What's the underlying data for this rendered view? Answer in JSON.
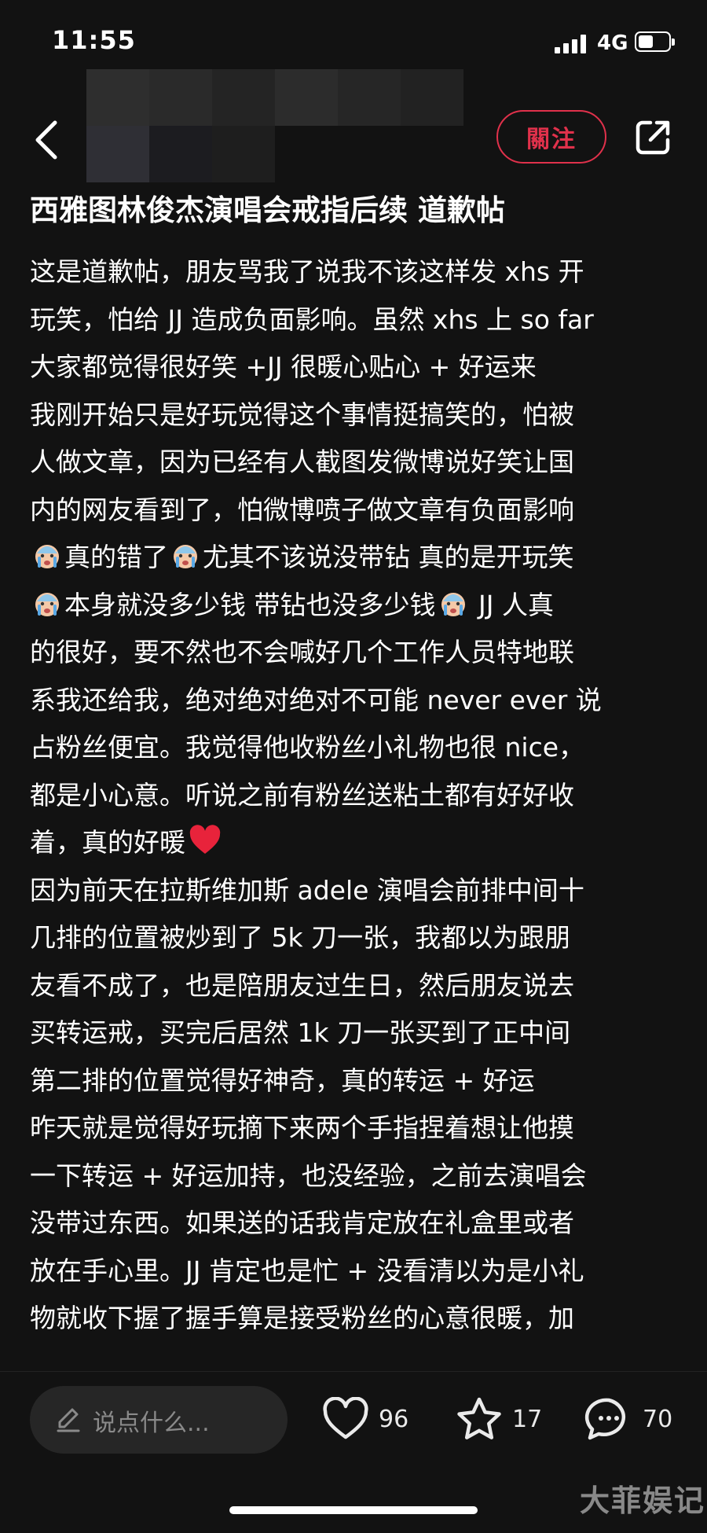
{
  "status_bar": {
    "time": "11:55",
    "network": "4G"
  },
  "header": {
    "follow_label": "關注"
  },
  "post": {
    "title": "西雅图林俊杰演唱会戒指后续 道歉帖",
    "lines": [
      "这是道歉帖，朋友骂我了说我不该这样发 xhs 开",
      "玩笑，怕给 JJ 造成负面影响。虽然 xhs 上 so far",
      "大家都觉得很好笑 +JJ 很暖心贴心 + 好运来",
      "我刚开始只是好玩觉得这个事情挺搞笑的，怕被",
      "人做文章，因为已经有人截图发微博说好笑让国",
      "内的网友看到了，怕微博喷子做文章有负面影响",
      {
        "e1": "真的错了",
        "e2": "尤其不该说没带钻 真的是开玩笑"
      },
      {
        "e1": "本身就没多少钱 带钻也没多少钱",
        "e2": " JJ 人真"
      },
      "的很好，要不然也不会喊好几个工作人员特地联",
      "系我还给我，绝对绝对绝对不可能 never ever 说",
      "占粉丝便宜。我觉得他收粉丝小礼物也很 nice，",
      "都是小心意。听说之前有粉丝送粘土都有好好收",
      {
        "text": "着，真的好暖"
      },
      "因为前天在拉斯维加斯 adele 演唱会前排中间十",
      "几排的位置被炒到了 5k 刀一张，我都以为跟朋",
      "友看不成了，也是陪朋友过生日，然后朋友说去",
      "买转运戒，买完后居然 1k 刀一张买到了正中间",
      "第二排的位置觉得好神奇，真的转运 + 好运",
      "昨天就是觉得好玩摘下来两个手指捏着想让他摸",
      "一下转运 + 好运加持，也没经验，之前去演唱会",
      "没带过东西。如果送的话我肯定放在礼盒里或者",
      "放在手心里。JJ 肯定也是忙 + 没看清以为是小礼",
      "物就收下握了握手算是接受粉丝的心意很暖，加"
    ]
  },
  "bottom_bar": {
    "comment_placeholder": "说点什么...",
    "likes": "96",
    "collects": "17",
    "comments": "70"
  },
  "watermark": "大菲娱记",
  "icons": {
    "back": "chevron-left-icon",
    "share": "share-icon",
    "pen": "pen-icon",
    "like": "heart-icon",
    "collect": "star-icon",
    "comment": "chat-bubble-icon",
    "emoji": "crying-face-emoji",
    "red_heart": "red-heart-emoji"
  },
  "colors": {
    "accent": "#e0314b",
    "background": "#121212",
    "heart": "#e8233b"
  }
}
